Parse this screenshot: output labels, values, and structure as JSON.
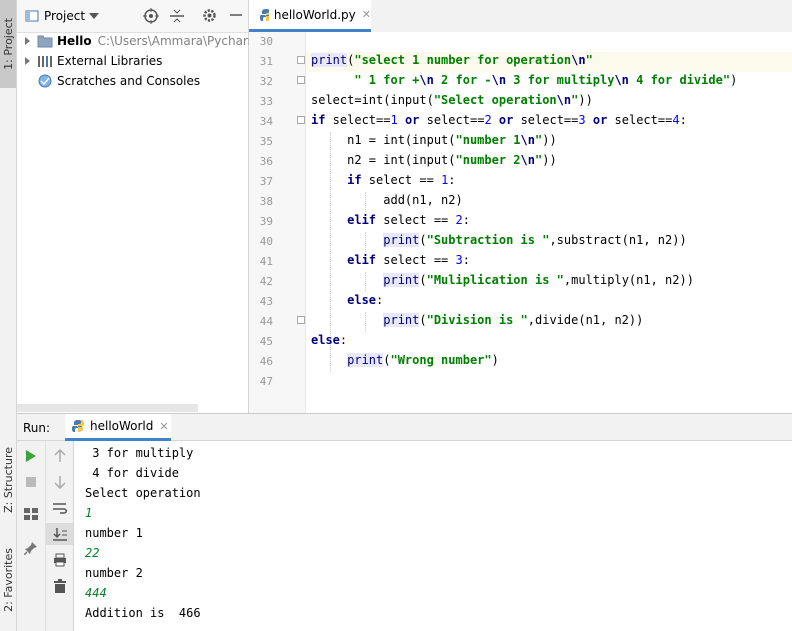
{
  "left_strip": {
    "project_tab": "1: Project",
    "structure_tab": "Z: Structure",
    "favorites_tab": "2: Favorites"
  },
  "project": {
    "header_title": "Project",
    "tree": [
      {
        "label": "Hello",
        "path": "C:\\Users\\Ammara\\PycharmPr",
        "icon": "folder-icon"
      },
      {
        "label": "External Libraries",
        "icon": "libraries-icon"
      },
      {
        "label": "Scratches and Consoles",
        "icon": "scratches-icon"
      }
    ]
  },
  "editor": {
    "tab_label": "helloWorld.py",
    "line_numbers": [
      "30",
      "31",
      "32",
      "33",
      "34",
      "35",
      "36",
      "37",
      "38",
      "39",
      "40",
      "41",
      "42",
      "43",
      "44",
      "45",
      "46",
      "47"
    ]
  },
  "run": {
    "label": "Run:",
    "tab_label": "helloWorld",
    "output": [
      {
        "text": " 3 for multiply",
        "input": false
      },
      {
        "text": " 4 for divide",
        "input": false
      },
      {
        "text": "Select operation",
        "input": false
      },
      {
        "text": "1",
        "input": true
      },
      {
        "text": "number 1",
        "input": false
      },
      {
        "text": "22",
        "input": true
      },
      {
        "text": "number 2",
        "input": false
      },
      {
        "text": "444",
        "input": true
      },
      {
        "text": "Addition is  466",
        "input": false
      }
    ]
  },
  "colors": {
    "accent": "#4083c9",
    "keyword": "#000080",
    "string": "#008000",
    "console_input": "#00802b",
    "run_green": "#3ea23e"
  }
}
